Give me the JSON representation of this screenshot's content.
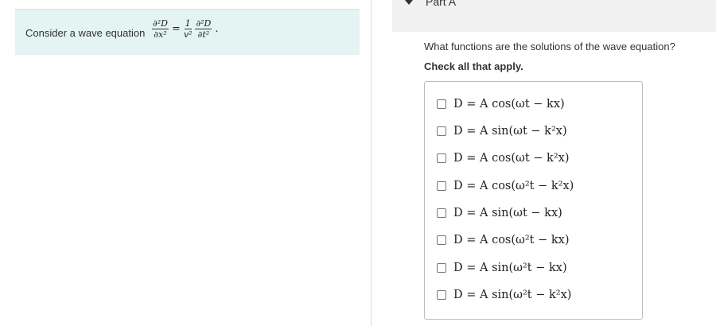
{
  "prompt": {
    "text": "Consider a wave equation",
    "equation": {
      "lhs_num": "∂²D",
      "lhs_den": "∂x²",
      "equals": "=",
      "coef_num": "1",
      "coef_den": "v²",
      "rhs_num": "∂²D",
      "rhs_den": "∂t²",
      "end": "."
    }
  },
  "part": {
    "title": "Part A",
    "question": "What functions are the solutions of the wave equation?",
    "instruction": "Check all that apply."
  },
  "options": [
    {
      "label": "D = A cos(ωt − kx)",
      "checked": false
    },
    {
      "label": "D = A sin(ωt − k²x)",
      "checked": false
    },
    {
      "label": "D = A cos(ωt − k²x)",
      "checked": false
    },
    {
      "label": "D = A cos(ω²t − k²x)",
      "checked": false
    },
    {
      "label": "D = A sin(ωt − kx)",
      "checked": false
    },
    {
      "label": "D = A cos(ω²t − kx)",
      "checked": false
    },
    {
      "label": "D = A sin(ω²t − kx)",
      "checked": false
    },
    {
      "label": "D = A sin(ω²t − k²x)",
      "checked": false
    }
  ],
  "colors": {
    "prompt_bg": "#e3f4f2",
    "header_bg": "#f1f1f1",
    "border": "#bdbdbd",
    "text": "#333333"
  }
}
